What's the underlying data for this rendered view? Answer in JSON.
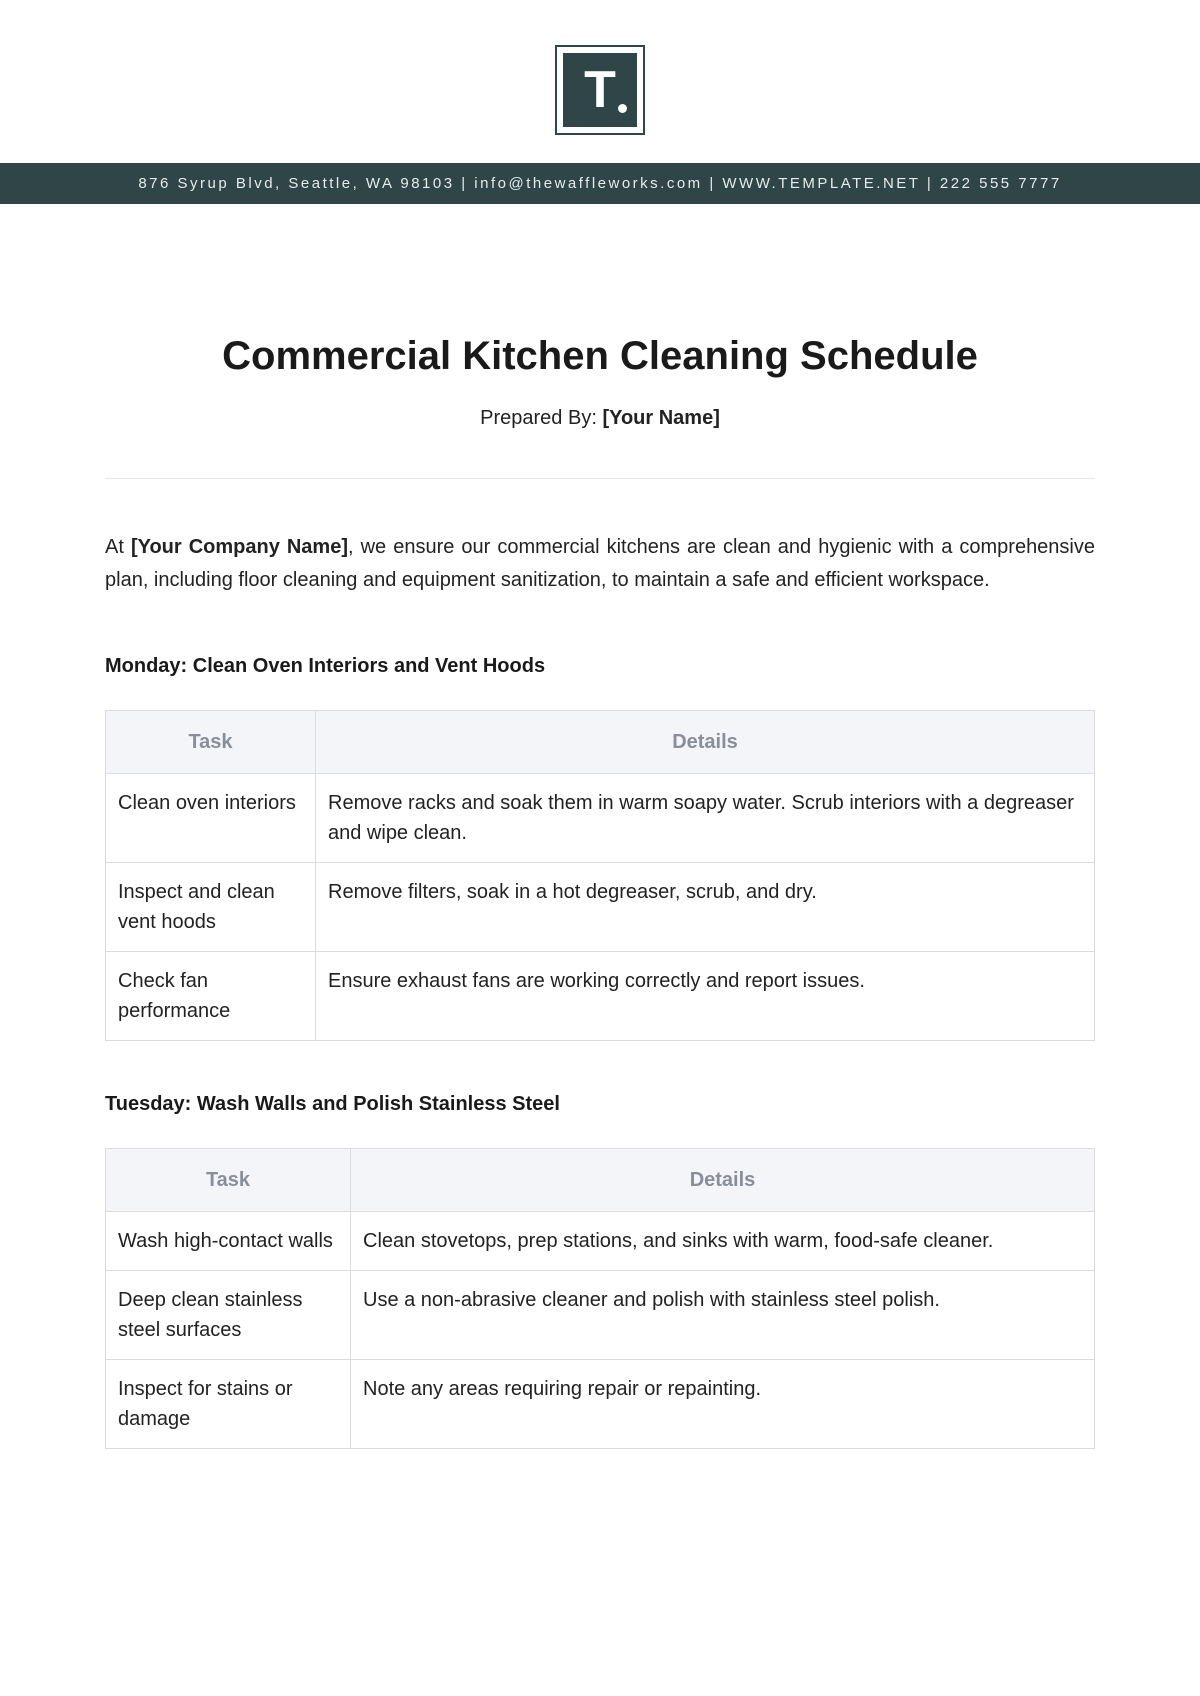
{
  "logo": {
    "letter": "T"
  },
  "info_bar": "876 Syrup Blvd, Seattle, WA 98103 | info@thewaffleworks.com | WWW.TEMPLATE.NET | 222 555 7777",
  "title": "Commercial Kitchen Cleaning Schedule",
  "prepared_by": {
    "label": "Prepared By: ",
    "value": "[Your Name]"
  },
  "intro": {
    "prefix": "At ",
    "bold": "[Your Company Name]",
    "rest": ", we ensure our commercial kitchens are clean and hygienic with a comprehensive plan, including floor cleaning and equipment sanitization, to maintain a safe and efficient workspace."
  },
  "table_headers": {
    "task": "Task",
    "details": "Details"
  },
  "sections": [
    {
      "heading": "Monday: Clean Oven Interiors and Vent Hoods",
      "rows": [
        {
          "task": "Clean oven interiors",
          "details": "Remove racks and soak them in warm soapy water. Scrub interiors with a degreaser and wipe clean."
        },
        {
          "task": "Inspect and clean vent hoods",
          "details": "Remove filters, soak in a hot degreaser, scrub, and dry."
        },
        {
          "task": "Check fan performance",
          "details": "Ensure exhaust fans are working correctly and report issues."
        }
      ]
    },
    {
      "heading": "Tuesday: Wash Walls and Polish Stainless Steel",
      "rows": [
        {
          "task": "Wash high-contact walls",
          "details": "Clean stovetops, prep stations, and sinks with warm, food-safe cleaner."
        },
        {
          "task": "Deep clean stainless steel surfaces",
          "details": "Use a non-abrasive cleaner and polish with stainless steel polish."
        },
        {
          "task": "Inspect for stains or damage",
          "details": "Note any areas requiring repair or repainting."
        }
      ]
    }
  ]
}
